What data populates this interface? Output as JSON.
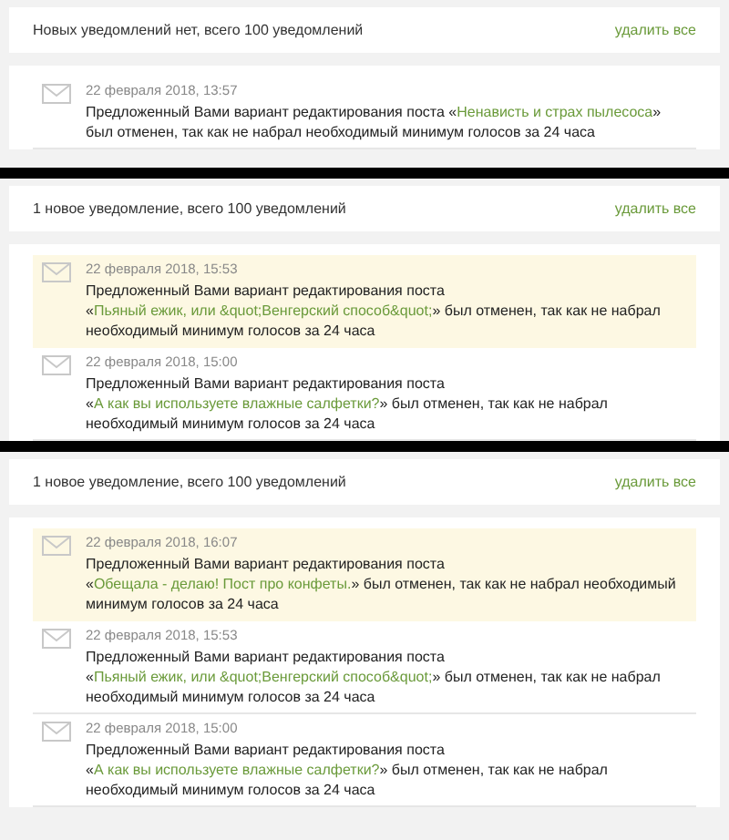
{
  "panels": [
    {
      "summary": "Новых уведомлений нет, всего 100 уведомлений",
      "delete_label": "удалить все",
      "notifications": [
        {
          "date": "22 февраля 2018, 13:57",
          "before": "Предложенный Вами вариант редактирования поста «",
          "link": "Ненависть и страх пылесоса",
          "after": "» был отменен, так как не набрал необходимый минимум голосов за 24 часа",
          "unread": false
        }
      ]
    },
    {
      "summary": "1 новое уведомление, всего 100 уведомлений",
      "delete_label": "удалить все",
      "notifications": [
        {
          "date": "22 февраля 2018, 15:53",
          "before": "Предложенный Вами вариант редактирования поста «",
          "link": "Пьяный ежик, или &quot;Венгерский способ&quot;",
          "after": "» был отменен, так как не набрал необходимый минимум голосов за 24 часа",
          "unread": true
        },
        {
          "date": "22 февраля 2018, 15:00",
          "before": "Предложенный Вами вариант редактирования поста «",
          "link": "А как вы используете влажные салфетки?",
          "after": "» был отменен, так как не набрал необходимый минимум голосов за 24 часа",
          "unread": false
        }
      ]
    },
    {
      "summary": "1 новое уведомление, всего 100 уведомлений",
      "delete_label": "удалить все",
      "notifications": [
        {
          "date": "22 февраля 2018, 16:07",
          "before": "Предложенный Вами вариант редактирования поста «",
          "link": "Обещала - делаю! Пост про конфеты.",
          "after": "» был отменен, так как не набрал необходимый минимум голосов за 24 часа",
          "unread": true
        },
        {
          "date": "22 февраля 2018, 15:53",
          "before": "Предложенный Вами вариант редактирования поста «",
          "link": "Пьяный ежик, или &quot;Венгерский способ&quot;",
          "after": "» был отменен, так как не набрал необходимый минимум голосов за 24 часа",
          "unread": false
        },
        {
          "date": "22 февраля 2018, 15:00",
          "before": "Предложенный Вами вариант редактирования поста «",
          "link": "А как вы используете влажные салфетки?",
          "after": "» был отменен, так как не набрал необходимый минимум голосов за 24 часа",
          "unread": false
        }
      ]
    }
  ]
}
